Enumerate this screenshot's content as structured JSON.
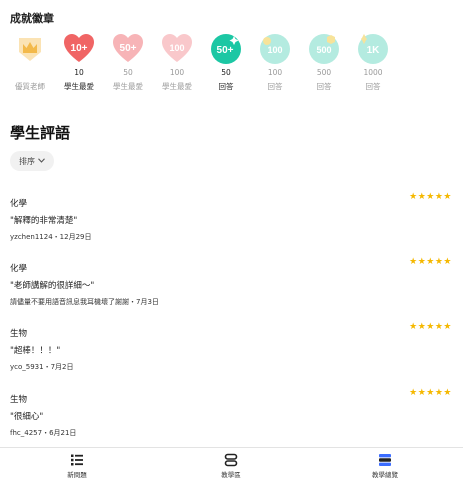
{
  "badges_section": {
    "title": "成就徽章",
    "badges": [
      {
        "icon": "crown-badge-icon",
        "count": "",
        "label": "優質老師",
        "color": "#f7d28a",
        "state": "faded"
      },
      {
        "icon": "heart-badge-icon",
        "count": "10",
        "label": "學生最愛",
        "color": "#f06565",
        "state": "active",
        "badge_text": "10+"
      },
      {
        "icon": "heart-badge-icon",
        "count": "50",
        "label": "學生最愛",
        "color": "#f7b4b7",
        "state": "faded",
        "badge_text": "50+"
      },
      {
        "icon": "heart-badge-icon",
        "count": "100",
        "label": "學生最愛",
        "color": "#f9c8cb",
        "state": "faded",
        "badge_text": "100"
      },
      {
        "icon": "answer-badge-icon",
        "count": "50",
        "label": "回答",
        "color": "#1cc7a4",
        "state": "active",
        "badge_text": "50+"
      },
      {
        "icon": "answer-badge-icon",
        "count": "100",
        "label": "回答",
        "color": "#a7e6da",
        "state": "faded",
        "badge_text": "100"
      },
      {
        "icon": "answer-badge-icon",
        "count": "500",
        "label": "回答",
        "color": "#a7e6da",
        "state": "faded",
        "badge_text": "500"
      },
      {
        "icon": "answer-badge-icon",
        "count": "1000",
        "label": "回答",
        "color": "#a7e6da",
        "state": "faded",
        "badge_text": "1K"
      }
    ]
  },
  "reviews_section": {
    "title": "學生評語",
    "sort_label": "排序",
    "star_color": "#f5b800",
    "reviews": [
      {
        "subject": "化學",
        "stars": "★★★★★",
        "comment": "\"解釋的非常清楚\"",
        "meta": "yzchen1124・12月29日"
      },
      {
        "subject": "化學",
        "stars": "★★★★★",
        "comment": "\"老師講解的很詳細～\"",
        "meta": "請儘量不要用語音訊息我耳機壞了謝謝・7月3日"
      },
      {
        "subject": "生物",
        "stars": "★★★★★",
        "comment": "\"超棒！！！\"",
        "meta": "yco_5931・7月2日"
      },
      {
        "subject": "生物",
        "stars": "★★★★★",
        "comment": "\"很細心\"",
        "meta": "fhc_4257・6月21日"
      }
    ]
  },
  "bottom_nav": {
    "items": [
      {
        "label": "新問題",
        "icon": "list-icon"
      },
      {
        "label": "教學區",
        "icon": "classroom-icon"
      },
      {
        "label": "教學總覽",
        "icon": "overview-icon",
        "active": true
      }
    ],
    "accent": "#3b6cff"
  }
}
